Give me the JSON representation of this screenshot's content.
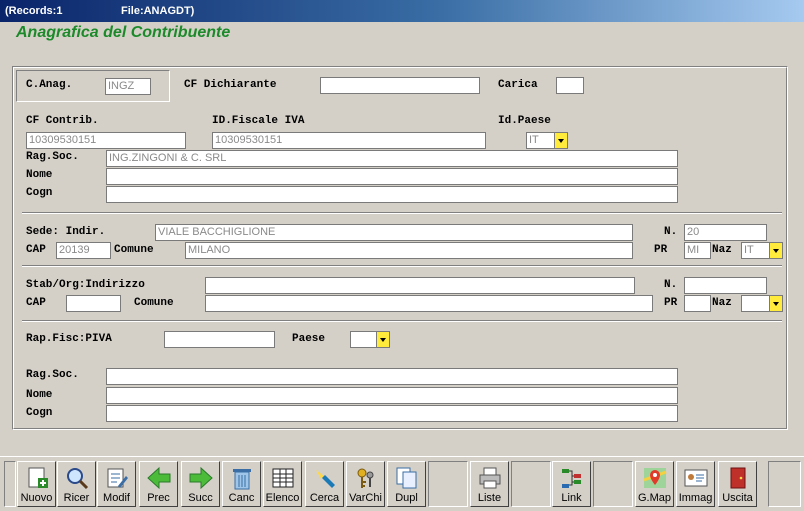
{
  "window": {
    "records": "(Records:1",
    "file": "File:ANAGDT)"
  },
  "app_title": "Anagrafica del Contribuente",
  "header": {
    "c_anag_label": "C.Anag.",
    "c_anag_value": "INGZ",
    "cf_dichiarante_label": "CF Dichiarante",
    "cf_dichiarante_value": "",
    "carica_label": "Carica",
    "carica_value": ""
  },
  "contrib": {
    "cf_label": "CF Contrib.",
    "cf_value": "10309530151",
    "idfiscale_label": "ID.Fiscale IVA",
    "idfiscale_value": "10309530151",
    "idpaese_label": "Id.Paese",
    "idpaese_value": "IT",
    "ragsoc_label": "Rag.Soc.",
    "ragsoc_value": "ING.ZINGONI & C. SRL",
    "nome_label": "Nome",
    "nome_value": "",
    "cogn_label": "Cogn",
    "cogn_value": ""
  },
  "sede": {
    "indir_label": "Sede: Indir.",
    "indir_value": "VIALE BACCHIGLIONE",
    "n_label": "N.",
    "n_value": "20",
    "cap_label": "CAP",
    "cap_value": "20139",
    "comune_label": "Comune",
    "comune_value": "MILANO",
    "pr_label": "PR",
    "pr_value": "MI",
    "naz_label": "Naz",
    "naz_value": "IT"
  },
  "stab": {
    "indir_label": "Stab/Org:Indirizzo",
    "indir_value": "",
    "n_label": "N.",
    "n_value": "",
    "cap_label": "CAP",
    "cap_value": "",
    "comune_label": "Comune",
    "comune_value": "",
    "pr_label": "PR",
    "pr_value": "",
    "naz_label": "Naz",
    "naz_value": ""
  },
  "rap": {
    "piva_label": "Rap.Fisc:PIVA",
    "piva_value": "",
    "paese_label": "Paese",
    "paese_value": "",
    "ragsoc_label": "Rag.Soc.",
    "ragsoc_value": "",
    "nome_label": "Nome",
    "nome_value": "",
    "cogn_label": "Cogn",
    "cogn_value": ""
  },
  "toolbar": {
    "nuovo": "Nuovo",
    "ricer": "Ricer",
    "modif": "Modif",
    "prec": "Prec",
    "succ": "Succ",
    "canc": "Canc",
    "elenco": "Elenco",
    "cerca": "Cerca",
    "varchi": "VarChi",
    "dupl": "Dupl",
    "liste": "Liste",
    "link": "Link",
    "gmap": "G.Map",
    "immag": "Immag",
    "uscita": "Uscita"
  },
  "colors": {
    "accent_yellow": "#ffeb3b",
    "title_green": "#1c8a2a",
    "titlebar_blue": "#0a246a"
  }
}
